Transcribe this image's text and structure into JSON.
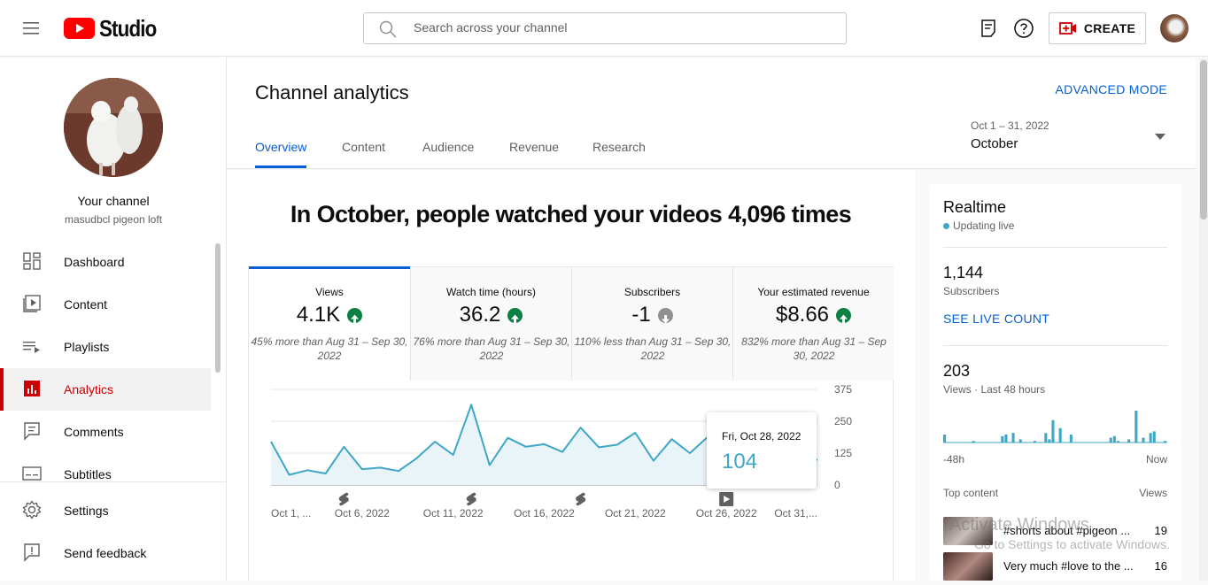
{
  "app": {
    "logo_text": "Studio"
  },
  "search": {
    "placeholder": "Search across your channel"
  },
  "header": {
    "create_label": "CREATE"
  },
  "sidebar": {
    "your_channel": "Your channel",
    "channel_name": "masudbcl pigeon loft",
    "items": [
      {
        "label": "Dashboard",
        "icon": "dashboard-icon"
      },
      {
        "label": "Content",
        "icon": "content-icon"
      },
      {
        "label": "Playlists",
        "icon": "playlists-icon"
      },
      {
        "label": "Analytics",
        "icon": "analytics-icon",
        "active": true
      },
      {
        "label": "Comments",
        "icon": "comments-icon"
      },
      {
        "label": "Subtitles",
        "icon": "subtitles-icon"
      }
    ],
    "footer": [
      {
        "label": "Settings",
        "icon": "settings-icon"
      },
      {
        "label": "Send feedback",
        "icon": "feedback-icon"
      }
    ]
  },
  "page": {
    "title": "Channel analytics",
    "advanced_mode": "ADVANCED MODE",
    "tabs": [
      "Overview",
      "Content",
      "Audience",
      "Revenue",
      "Research"
    ],
    "active_tab": "Overview",
    "date_range": "Oct 1 – 31, 2022",
    "date_label": "October",
    "headline": "In October, people watched your videos 4,096 times"
  },
  "metrics": [
    {
      "title": "Views",
      "value": "4.1K",
      "trend": "up",
      "note": "45% more than Aug 31 – Sep 30, 2022"
    },
    {
      "title": "Watch time (hours)",
      "value": "36.2",
      "trend": "up",
      "note": "76% more than Aug 31 – Sep 30, 2022"
    },
    {
      "title": "Subscribers",
      "value": "-1",
      "trend": "down",
      "note": "110% less than Aug 31 – Sep 30, 2022"
    },
    {
      "title": "Your estimated revenue",
      "value": "$8.66",
      "trend": "up",
      "note": "832% more than Aug 31 – Sep 30, 2022"
    }
  ],
  "colors": {
    "accent": "#065fd4",
    "brand_red": "#ff0000",
    "active_red": "#cc0000",
    "up_green": "#0b8043",
    "down_grey": "#909090",
    "chart_line": "#3ea6c6"
  },
  "chart_data": {
    "type": "area",
    "ylim": [
      0,
      375
    ],
    "yticks": [
      "375",
      "250",
      "125",
      "0"
    ],
    "xtick_labels": [
      "Oct 1, ...",
      "Oct 6, 2022",
      "Oct 11, 2022",
      "Oct 16, 2022",
      "Oct 21, 2022",
      "Oct 26, 2022",
      "Oct 31,..."
    ],
    "x": [
      1,
      2,
      3,
      4,
      5,
      6,
      7,
      8,
      9,
      10,
      11,
      12,
      13,
      14,
      15,
      16,
      17,
      18,
      19,
      20,
      21,
      22,
      23,
      24,
      25,
      26,
      27,
      28,
      29,
      30,
      31
    ],
    "values": [
      170,
      40,
      58,
      45,
      150,
      62,
      68,
      55,
      105,
      170,
      118,
      315,
      78,
      185,
      150,
      160,
      130,
      225,
      148,
      158,
      205,
      95,
      180,
      125,
      190,
      180,
      120,
      104,
      112,
      130,
      98
    ],
    "markers": [
      {
        "type": "short",
        "x": 5
      },
      {
        "type": "short",
        "x": 12
      },
      {
        "type": "short",
        "x": 18
      },
      {
        "type": "video",
        "x": 26
      }
    ],
    "tooltip": {
      "date": "Fri, Oct 28, 2022",
      "value": "104"
    }
  },
  "realtime": {
    "title": "Realtime",
    "status": "Updating live",
    "subscribers": "1,144",
    "subscribers_label": "Subscribers",
    "see_live": "SEE LIVE COUNT",
    "views": "203",
    "views_label": "Views · Last 48 hours",
    "axis_start": "-48h",
    "axis_end": "Now",
    "bars": [
      0.25,
      0,
      0,
      0,
      0,
      0,
      0,
      0,
      0.05,
      0,
      0,
      0,
      0,
      0,
      0,
      0,
      0.2,
      0.25,
      0,
      0.3,
      0,
      0.1,
      0,
      0,
      0,
      0.05,
      0,
      0,
      0.3,
      0.1,
      0.7,
      0,
      0.45,
      0,
      0,
      0.25,
      0,
      0,
      0,
      0,
      0,
      0,
      0,
      0,
      0,
      0,
      0.15,
      0.2,
      0.05,
      0,
      0,
      0.1,
      0,
      1.0,
      0,
      0.15,
      0,
      0.3,
      0.35,
      0,
      0,
      0.05
    ],
    "top_content_label": "Top content",
    "views_col": "Views",
    "top_content": [
      {
        "title": "#shorts about #pigeon ...",
        "views": "19"
      },
      {
        "title": "Very much #love to the ...",
        "views": "16"
      }
    ]
  },
  "watermark": {
    "line1": "Activate Windows",
    "line2": "Go to Settings to activate Windows."
  }
}
